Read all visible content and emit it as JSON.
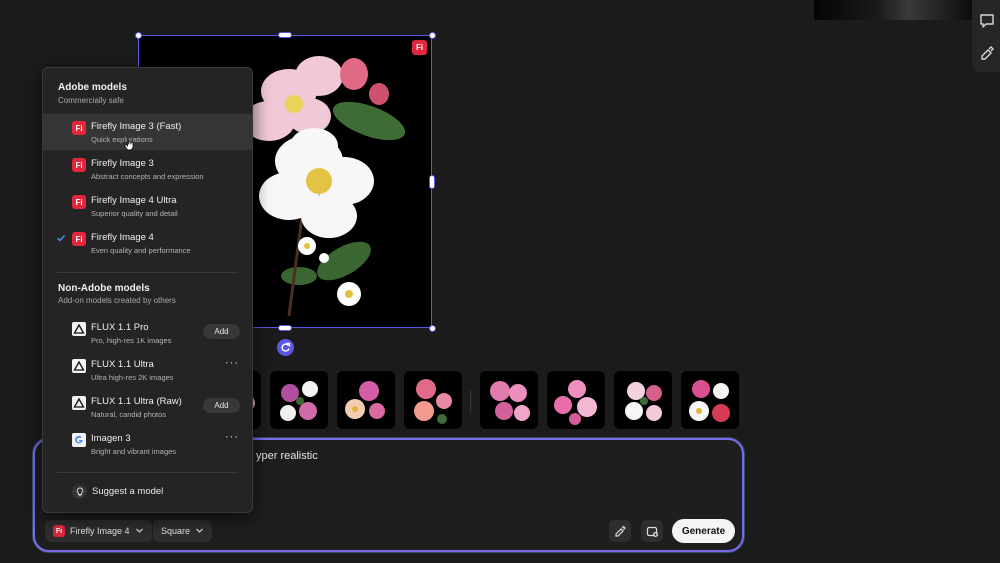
{
  "colors": {
    "accent": "#5b57e6",
    "firefly_red": "#e3263b",
    "check_blue": "#4b8df8"
  },
  "canvas": {
    "badge": "Fi"
  },
  "model_menu": {
    "adobe_section": {
      "title": "Adobe models",
      "subtitle": "Commercially safe"
    },
    "adobe_models": [
      {
        "badge": "Fi",
        "name": "Firefly Image 3 (Fast)",
        "desc": "Quick explorations"
      },
      {
        "badge": "Fi",
        "name": "Firefly Image 3",
        "desc": "Abstract concepts and expression"
      },
      {
        "badge": "Fi",
        "name": "Firefly Image 4 Ultra",
        "desc": "Superior quality and detail"
      },
      {
        "badge": "Fi",
        "name": "Firefly Image 4",
        "desc": "Even quality and performance"
      }
    ],
    "non_adobe_section": {
      "title": "Non-Adobe models",
      "subtitle": "Add-on models created by others"
    },
    "non_adobe_models": [
      {
        "icon": "flux-icon",
        "name": "FLUX 1.1 Pro",
        "desc": "Pro, high-res 1K images",
        "action": "Add"
      },
      {
        "icon": "flux-icon",
        "name": "FLUX 1.1 Ultra",
        "desc": "Ultra high-res 2K images",
        "action": "more"
      },
      {
        "icon": "flux-icon",
        "name": "FLUX 1.1 Ultra (Raw)",
        "desc": "Natural, candid photos",
        "action": "Add"
      },
      {
        "icon": "google-icon",
        "name": "Imagen 3",
        "desc": "Bright and vibrant images",
        "action": "more"
      }
    ],
    "add_label": "Add",
    "more_label": "···",
    "suggest_label": "Suggest a model"
  },
  "prompt": {
    "visible_text": "yper realistic",
    "model_badge": "Fi",
    "model_pill": "Firefly Image 4",
    "aspect_pill": "Square",
    "generate_label": "Generate"
  }
}
